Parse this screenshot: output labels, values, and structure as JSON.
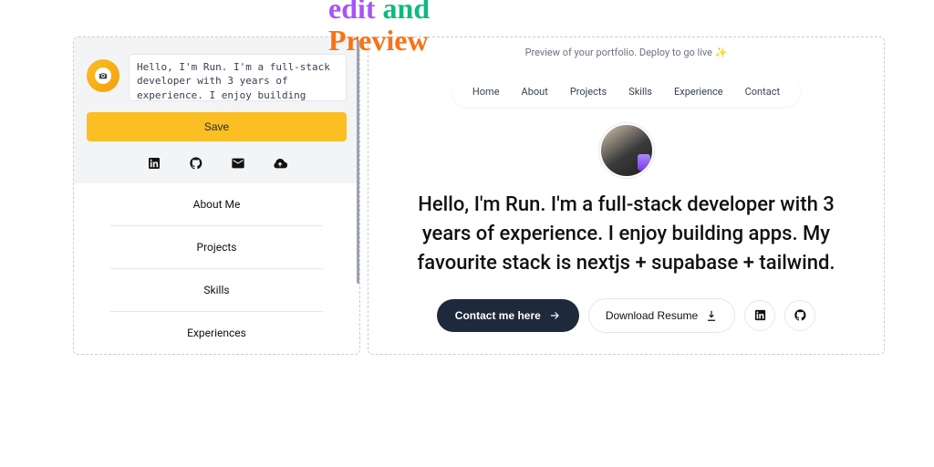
{
  "overlay": {
    "word1": "edit",
    "word2": "and",
    "word3": "Preview"
  },
  "editor": {
    "bio": "Hello, I'm Run. I'm a full-stack developer with 3 years of experience. I enjoy building apps. My favourite stack is nextjs + supabase + tailwind.",
    "save_label": "Save",
    "sections": [
      "About Me",
      "Projects",
      "Skills",
      "Experiences"
    ]
  },
  "preview": {
    "banner": "Preview of your portfolio. Deploy to go live ✨",
    "nav": [
      "Home",
      "About",
      "Projects",
      "Skills",
      "Experience",
      "Contact"
    ],
    "hero": "Hello, I'm Run. I'm a full-stack developer with 3 years of experience. I enjoy building apps. My favourite stack is nextjs + supabase + tailwind.",
    "contact_label": "Contact me here",
    "resume_label": "Download Resume"
  }
}
